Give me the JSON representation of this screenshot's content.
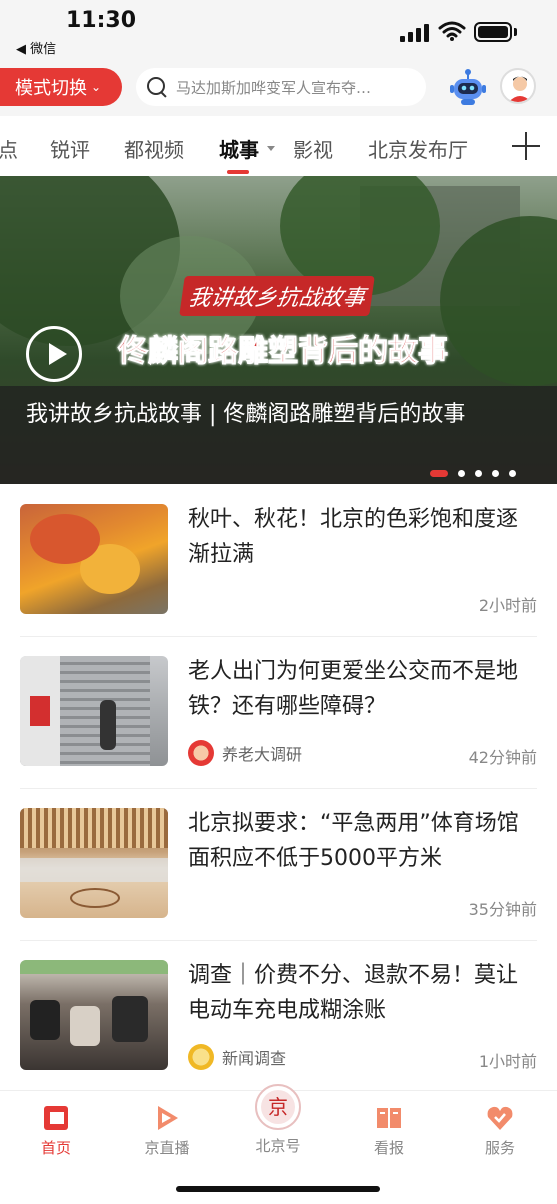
{
  "status_bar": {
    "time": "11:30",
    "back_app": "◀ 微信"
  },
  "header": {
    "mode_button": "模式切换",
    "search_placeholder": "马达加斯加哗变军人宣布夺…"
  },
  "tabs": [
    {
      "label": "点"
    },
    {
      "label": "锐评"
    },
    {
      "label": "都视频"
    },
    {
      "label": "城事",
      "active": true
    },
    {
      "label": "影视"
    },
    {
      "label": "北京发布厅"
    }
  ],
  "banner": {
    "ribbon_text": "我讲故乡抗战故事",
    "overlay_title": "佟麟阁路雕塑背后的故事",
    "caption": "我讲故乡抗战故事 | 佟麟阁路雕塑背后的故事",
    "slide_count": 5,
    "active_slide": 1
  },
  "news": [
    {
      "title": "秋叶、秋花！北京的色彩饱和度逐渐拉满",
      "source": "",
      "time": "2小时前"
    },
    {
      "title": "老人出门为何更爱坐公交而不是地铁？还有哪些障碍？",
      "source": "养老大调研",
      "time": "42分钟前"
    },
    {
      "title": "北京拟要求：“平急两用”体育场馆面积应不低于5000平方米",
      "source": "",
      "time": "35分钟前"
    },
    {
      "title": "调查｜价费不分、退款不易！莫让电动车充电成糊涂账",
      "source": "新闻调查",
      "time": "1小时前"
    }
  ],
  "bottom_nav": [
    {
      "label": "首页",
      "icon": "home-icon",
      "active": true
    },
    {
      "label": "京直播",
      "icon": "live-icon"
    },
    {
      "label": "北京号",
      "icon": "beijing-hao-icon"
    },
    {
      "label": "看报",
      "icon": "newspaper-icon"
    },
    {
      "label": "服务",
      "icon": "service-icon"
    }
  ],
  "colors": {
    "accent": "#e53935",
    "text": "#222222",
    "muted": "#888888"
  }
}
